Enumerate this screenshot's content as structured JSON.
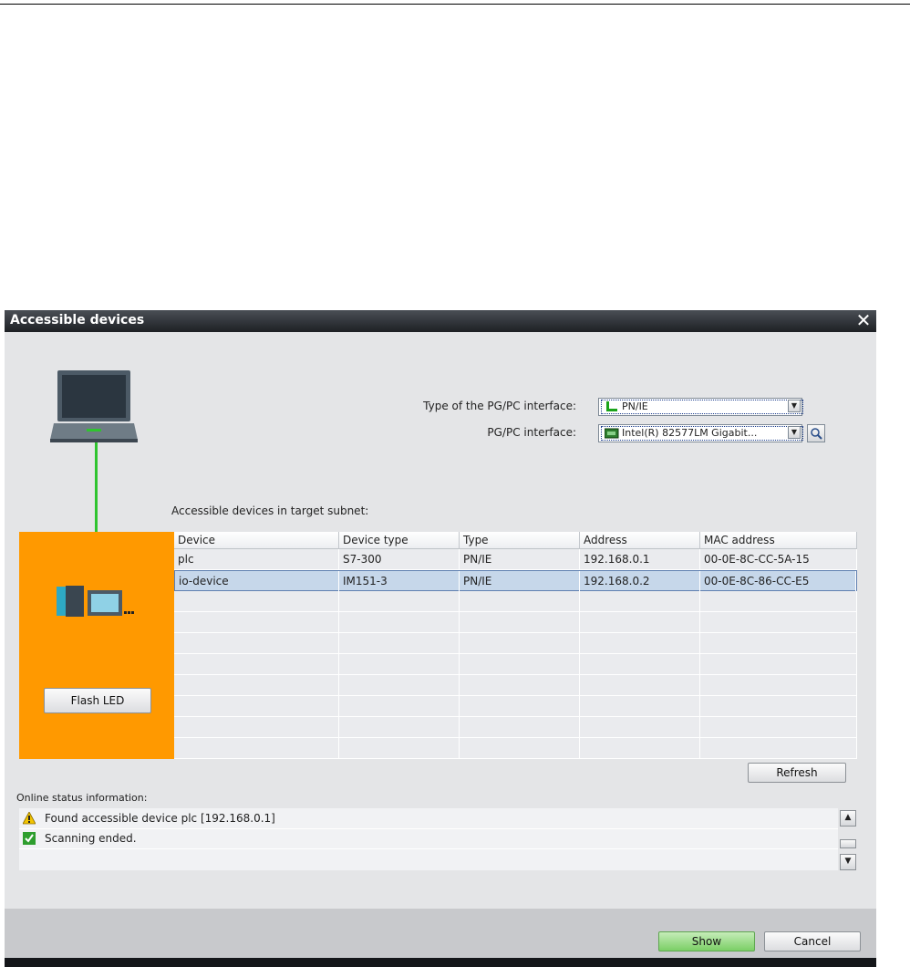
{
  "dialog": {
    "title": "Accessible devices",
    "close_icon": "close-icon"
  },
  "interface": {
    "type_label": "Type of the PG/PC interface:",
    "type_value": "PN/IE",
    "pgpc_label": "PG/PC interface:",
    "pgpc_value": "Intel(R) 82577LM Gigabit..."
  },
  "subnet_label": "Accessible devices in target subnet:",
  "flash_led_label": "Flash LED",
  "table": {
    "columns": [
      "Device",
      "Device type",
      "Type",
      "Address",
      "MAC address"
    ],
    "rows": [
      [
        "plc",
        "S7-300",
        "PN/IE",
        "192.168.0.1",
        "00-0E-8C-CC-5A-15"
      ],
      [
        "io-device",
        "IM151-3",
        "PN/IE",
        "192.168.0.2",
        "00-0E-8C-86-CC-E5"
      ]
    ],
    "selected_row": 1,
    "empty_rows": 8
  },
  "refresh_label": "Refresh",
  "status": {
    "label": "Online status information:",
    "messages": [
      {
        "icon": "warning-icon",
        "text": "Found accessible device plc [192.168.0.1]"
      },
      {
        "icon": "check-icon",
        "text": "Scanning ended."
      }
    ]
  },
  "buttons": {
    "show": "Show",
    "cancel": "Cancel"
  },
  "colors": {
    "accent_orange": "#ff9900",
    "connection_green": "#2fc42f",
    "selection": "#c6d7ea"
  }
}
